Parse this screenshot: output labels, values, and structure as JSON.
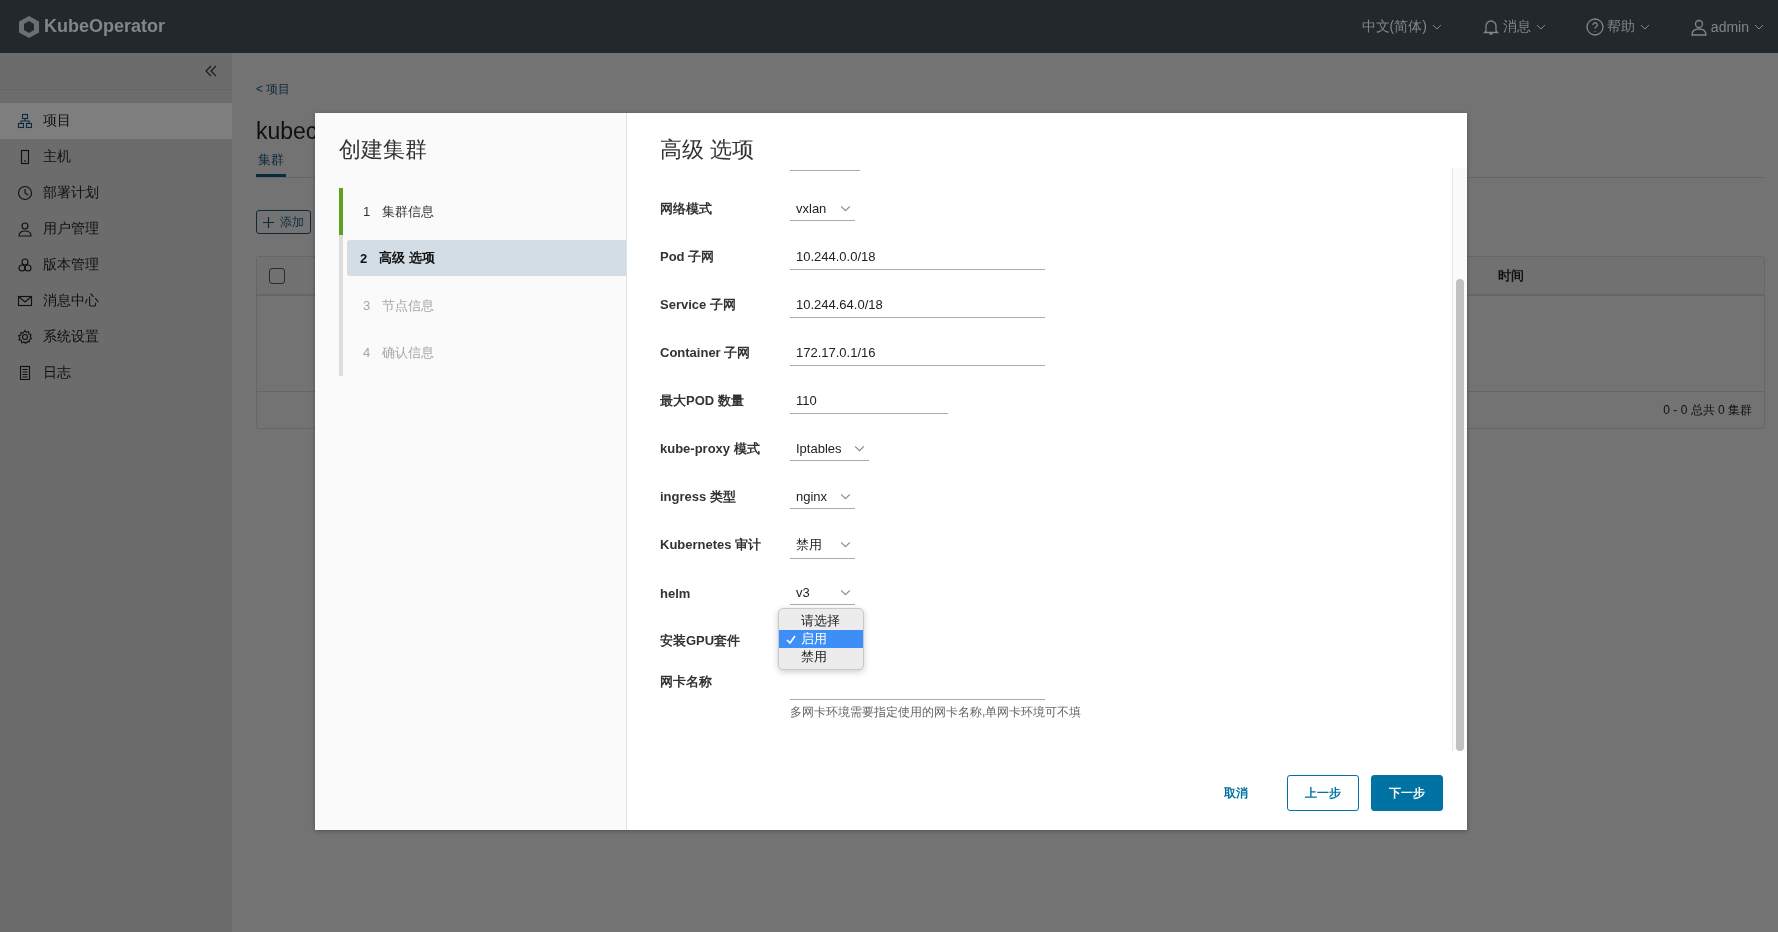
{
  "header": {
    "logo": "KubeOperator",
    "language": "中文(简体)",
    "messages": "消息",
    "help": "帮助",
    "user": "admin"
  },
  "sidebar": {
    "items": [
      {
        "label": "项目",
        "selected": true
      },
      {
        "label": "主机",
        "selected": false
      },
      {
        "label": "部署计划",
        "selected": false
      },
      {
        "label": "用户管理",
        "selected": false
      },
      {
        "label": "版本管理",
        "selected": false
      },
      {
        "label": "消息中心",
        "selected": false
      },
      {
        "label": "系统设置",
        "selected": false
      },
      {
        "label": "日志",
        "selected": false
      }
    ]
  },
  "page": {
    "breadcrumb": "< 项目",
    "title": "kubec",
    "tabs": [
      {
        "label": "集群",
        "selected": true
      }
    ],
    "add_button": "添加",
    "table": {
      "select_all": {
        "checked": false
      },
      "columns": [
        "时间"
      ],
      "footer": "0 - 0 总共 0 集群"
    }
  },
  "dialog": {
    "title": "创建集群",
    "steps": [
      {
        "number": "1",
        "label": "集群信息",
        "completed": true,
        "selected": false,
        "disabled": false
      },
      {
        "number": "2",
        "label": "高级 选项",
        "completed": false,
        "selected": true,
        "disabled": false
      },
      {
        "number": "3",
        "label": "节点信息",
        "completed": false,
        "selected": false,
        "disabled": true
      },
      {
        "number": "4",
        "label": "确认信息",
        "completed": false,
        "selected": false,
        "disabled": true
      }
    ],
    "section_title": "高级 选项",
    "fields": [
      {
        "kind": "cut"
      },
      {
        "kind": "select",
        "label": "网络模式",
        "value": "vxlan"
      },
      {
        "kind": "text",
        "label": "Pod 子网",
        "value": "10.244.0.0/18"
      },
      {
        "kind": "text",
        "label": "Service 子网",
        "value": "10.244.64.0/18"
      },
      {
        "kind": "text",
        "label": "Container 子网",
        "value": "172.17.0.1/16"
      },
      {
        "kind": "number",
        "label": "最大POD 数量",
        "value": "110"
      },
      {
        "kind": "select",
        "label": "kube-proxy 模式",
        "value": "Iptables"
      },
      {
        "kind": "select",
        "label": "ingress 类型",
        "value": "nginx"
      },
      {
        "kind": "select",
        "label": "Kubernetes 审计",
        "value": "禁用"
      },
      {
        "kind": "select",
        "label": "helm",
        "value": "v3"
      },
      {
        "kind": "select",
        "label": "安装GPU套件",
        "open": true,
        "options": [
          {
            "label": "请选择",
            "selected": false
          },
          {
            "label": "启用",
            "selected": true
          },
          {
            "label": "禁用",
            "selected": false
          }
        ]
      },
      {
        "kind": "text",
        "label": "网卡名称",
        "hint": "多网卡环境需要指定使用的网卡名称,单网卡环境可不填"
      }
    ],
    "buttons": {
      "cancel": "取消",
      "prev": "上一步",
      "next": "下一步"
    }
  }
}
